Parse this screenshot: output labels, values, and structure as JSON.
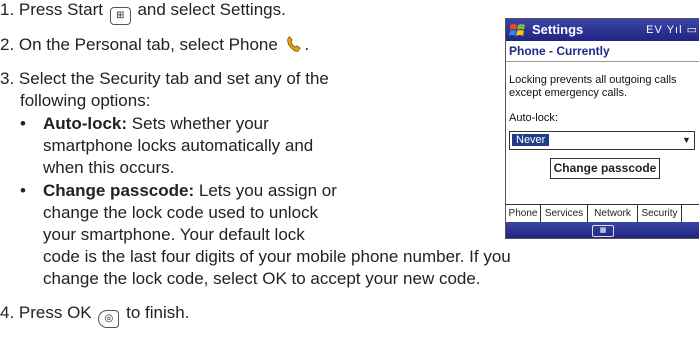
{
  "steps": {
    "step1": {
      "prefix": "1. Press Start",
      "suffix": "and select Settings.",
      "start_key_icon": "start-key-icon"
    },
    "step2": {
      "text": "2. On the Personal tab, select Phone",
      "phone_icon": "phone-icon"
    },
    "step3": {
      "line1": "3. Select the Security tab and set any of the",
      "line2": "following options:"
    },
    "bullet1": {
      "title": "Auto-lock:",
      "line1": "Sets whether your",
      "line2": "smartphone locks automatically and",
      "line3": "when this occurs."
    },
    "bullet2": {
      "title": "Change passcode:",
      "line1": "Lets you assign or",
      "line2": "change the lock code used to unlock",
      "line3": "your smartphone. Your default lock",
      "line4": "code is the last four digits of your mobile phone number. If you",
      "line5": "change the lock code, select OK to accept your new code."
    },
    "step4": {
      "prefix": "4. Press OK",
      "suffix": "to finish.",
      "ok_key_icon": "ok-key-icon"
    },
    "bullet_char": "•"
  },
  "device": {
    "title": "Settings",
    "status_text": "EV Yıl ▭",
    "subheader": "Phone - Currently",
    "info_line1": "Locking prevents all outgoing calls",
    "info_line2": "except emergency calls.",
    "autolock_label": "Auto-lock:",
    "autolock_value": "Never",
    "change_passcode_button": "Change passcode",
    "tabs": [
      {
        "label": "Phone"
      },
      {
        "label": "Services"
      },
      {
        "label": "Network"
      },
      {
        "label": "Security"
      }
    ],
    "active_tab": "Security",
    "colors": {
      "titlebar": "#2a3193",
      "selection": "#1f3d8a",
      "accent_text": "#1a2a8a"
    }
  }
}
